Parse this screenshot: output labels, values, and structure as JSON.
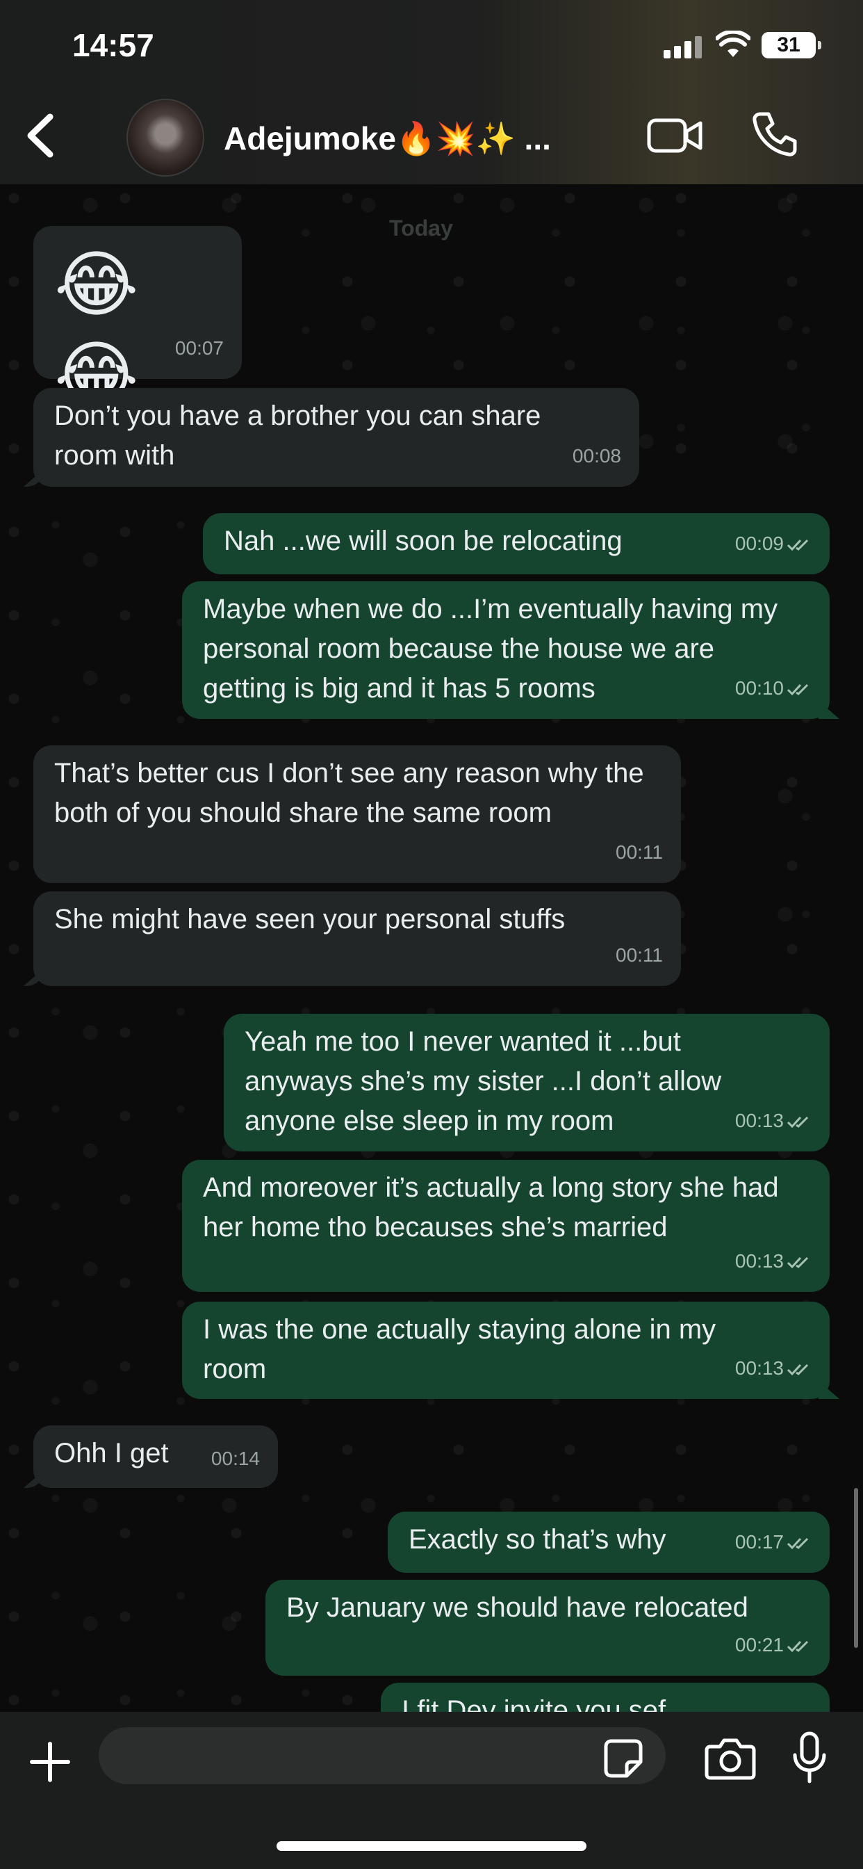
{
  "status": {
    "time": "14:57",
    "battery": "31"
  },
  "header": {
    "contact_name": "Adejumoke🔥💥✨ ..."
  },
  "date_separator": "Today",
  "messages": [
    {
      "dir": "in",
      "text": "😂 😂",
      "time": "00:07"
    },
    {
      "dir": "in",
      "text": "Don’t you have a brother you can share room with",
      "time": "00:08"
    },
    {
      "dir": "out",
      "text": "Nah ...we will soon be relocating",
      "time": "00:09"
    },
    {
      "dir": "out",
      "text": "Maybe when we do ...I’m eventually having my personal room because the house we are getting is big and it has 5 rooms",
      "time": "00:10"
    },
    {
      "dir": "in",
      "text": "That’s better cus I don’t see any reason why the both of you should share the same room",
      "time": "00:11"
    },
    {
      "dir": "in",
      "text": "She might have seen your personal stuffs",
      "time": "00:11"
    },
    {
      "dir": "out",
      "text": "Yeah me too I never wanted it ...but anyways she’s my sister ...I don’t allow anyone else sleep in my room",
      "time": "00:13"
    },
    {
      "dir": "out",
      "text": "And moreover it’s actually a long story she had her home tho becauses she’s married",
      "time": "00:13"
    },
    {
      "dir": "out",
      "text": "I was the one actually staying alone in my room",
      "time": "00:13"
    },
    {
      "dir": "in",
      "text": "Ohh I get",
      "time": "00:14"
    },
    {
      "dir": "out",
      "text": "Exactly so that’s why",
      "time": "00:17"
    },
    {
      "dir": "out",
      "text": "By January we should have relocated",
      "time": "00:21"
    },
    {
      "dir": "out",
      "text": "I fit Dey invite you sef",
      "time": ""
    }
  ],
  "input": {
    "value": "",
    "placeholder": ""
  },
  "icons": {
    "back": "chevron-left-icon",
    "video": "video-call-icon",
    "call": "phone-icon",
    "plus": "plus-icon",
    "sticker": "sticker-icon",
    "camera": "camera-icon",
    "mic": "microphone-icon",
    "read": "double-check-icon"
  },
  "colors": {
    "incoming_bubble": "#232627",
    "outgoing_bubble": "#15452f",
    "background": "#0b0b0b"
  }
}
